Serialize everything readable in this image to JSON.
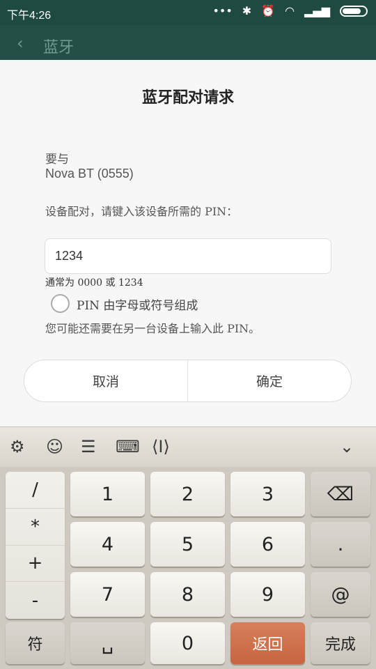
{
  "status": {
    "time": "下午4:26",
    "icons": [
      "dots-icon",
      "bluetooth-icon",
      "alarm-icon",
      "wifi-icon",
      "signal-icon",
      "battery-icon"
    ]
  },
  "appbar": {
    "title": "蓝牙"
  },
  "dialog": {
    "title": "蓝牙配对请求",
    "pair_with": "要与",
    "device_name": "Nova BT (0555)",
    "instruction": "设备配对，请键入该设备所需的 PIN：",
    "pin_value": "1234",
    "hint": "通常为 0000 或 1234",
    "radio_label": "PIN 由字母或符号组成",
    "note": "您可能还需要在另一台设备上输入此 PIN。",
    "cancel": "取消",
    "confirm": "确定"
  },
  "keyboard": {
    "toolbar_icons": [
      "gear-icon",
      "emoji-icon",
      "clipboard-icon",
      "keyboard-icon",
      "cursor-icon",
      "chevron-down-icon"
    ],
    "symbols": [
      "/",
      "*",
      "+",
      "-"
    ],
    "digits": [
      "1",
      "2",
      "3",
      "4",
      "5",
      "6",
      "7",
      "8",
      "9",
      "0"
    ],
    "dot": ".",
    "at": "@",
    "symbol_key": "符",
    "space_key": "␣",
    "return_key": "返回",
    "done_key": "完成"
  }
}
